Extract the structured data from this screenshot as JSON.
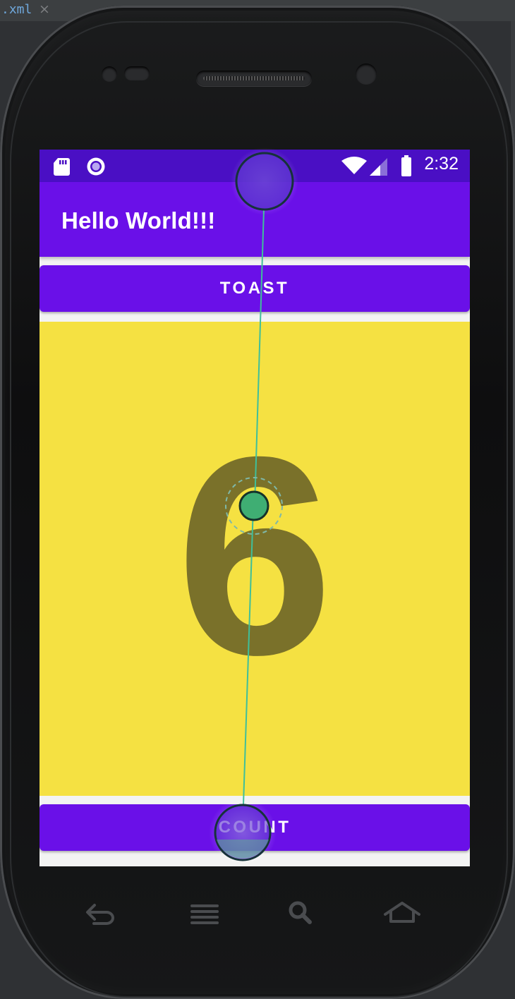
{
  "ide": {
    "tab_label": ".xml",
    "tab_close": "×"
  },
  "status_bar": {
    "time": "2:32",
    "icons": [
      "sd-card-icon",
      "sync-circle-icon",
      "wifi-icon",
      "signal-icon",
      "battery-icon"
    ]
  },
  "app_bar": {
    "title": "Hello World!!!"
  },
  "buttons": {
    "toast_label": "TOAST",
    "count_label": "COUNT"
  },
  "counter": {
    "value": "6"
  },
  "nav_keys": [
    "back-icon",
    "menu-icon",
    "search-icon",
    "home-icon"
  ],
  "colors": {
    "status_bar": "#4a0fc4",
    "app_bar": "#6a10e8",
    "button": "#6a10e8",
    "count_panel": "#f5e142",
    "count_text": "#7a712a",
    "touch_line": "#3fbf9a"
  }
}
